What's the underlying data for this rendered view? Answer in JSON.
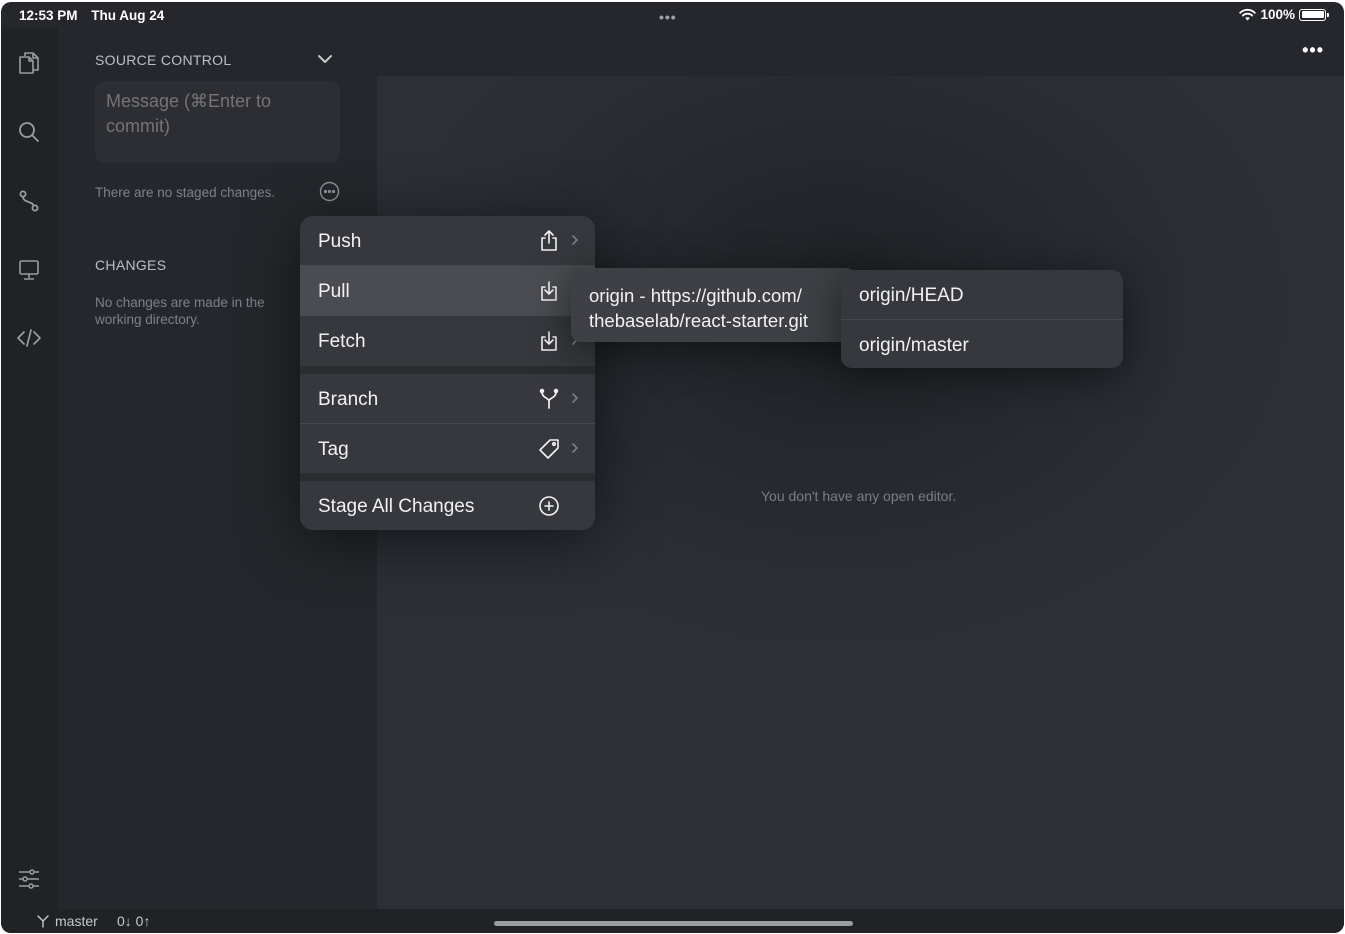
{
  "status_bar": {
    "time": "12:53 PM",
    "date": "Thu Aug 24",
    "battery": "100%"
  },
  "activity_bar": {
    "icons": [
      "files-icon",
      "search-icon",
      "source-control-icon",
      "remote-icon",
      "code-icon",
      "settings-sliders-icon"
    ]
  },
  "sidebar": {
    "title": "SOURCE CONTROL",
    "commit_placeholder": "Message (⌘Enter to commit)",
    "no_staged": "There are no staged changes.",
    "changes_title": "CHANGES",
    "no_changes": "No changes are made in the working directory."
  },
  "editor": {
    "more": "•••",
    "empty_message": "You don't have any open editor."
  },
  "menu": {
    "items": [
      {
        "label": "Push",
        "icon": "share-icon"
      },
      {
        "label": "Pull",
        "icon": "download-icon"
      },
      {
        "label": "Fetch",
        "icon": "download-icon"
      },
      {
        "label": "Branch",
        "icon": "branch-icon"
      },
      {
        "label": "Tag",
        "icon": "tag-icon"
      },
      {
        "label": "Stage All Changes",
        "icon": "plus-circle-icon"
      }
    ]
  },
  "submenu": {
    "remote_label": "origin - https://github.com/\nthebaselab/react-starter.git"
  },
  "submenu2": {
    "items": [
      "origin/HEAD",
      "origin/master"
    ]
  },
  "bottom_bar": {
    "branch": "master",
    "sync": "0↓ 0↑"
  },
  "colors": {
    "background": "#25272c",
    "activity_bar": "#202226",
    "menu": "#36383d",
    "menu_highlight": "#4a4c51"
  }
}
